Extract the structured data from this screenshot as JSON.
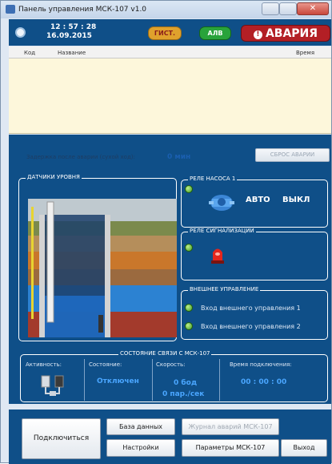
{
  "window": {
    "title": "Панель управления МСК-107 v1.0",
    "close_glyph": "✕"
  },
  "status_bar": {
    "time": "12 : 57 : 28",
    "date": "16.09.2015",
    "badge_gist": "ГИСТ.",
    "badge_alv": "АЛВ",
    "badge_alarm": "АВАРИЯ"
  },
  "event_table": {
    "columns": [
      "Код",
      "Название",
      "Время"
    ],
    "rows": []
  },
  "delay": {
    "label": "Задержка после аварии (сухой ход):",
    "value": "0 мин",
    "reset_button": "СБРОС АВАРИИ"
  },
  "level_sensors": {
    "title": "ДАТЧИКИ УРОВНЯ"
  },
  "pump_relay": {
    "title": "РЕЛЕ НАСОСА 1",
    "mode_auto": "АВТО",
    "mode_off": "ВЫКЛ"
  },
  "alarm_relay": {
    "title": "РЕЛЕ СИГНАЛИЗАЦИИ"
  },
  "external_control": {
    "title": "ВНЕШНЕЕ УПРАВЛЕНИЕ",
    "inputs": [
      "Вход внешнего управления 1",
      "Вход внешнего управления 2"
    ]
  },
  "connection": {
    "title": "СОСТОЯНИЕ СВЯЗИ С МСК-107",
    "activity_label": "Активность:",
    "state_label": "Состояние:",
    "state_value": "Отключен",
    "speed_label": "Скорость:",
    "speed_baud": "0 бод",
    "speed_packets": "0 пар./сек",
    "uptime_label": "Время подключения:",
    "uptime_value": "00 : 00 : 00"
  },
  "buttons": {
    "connect": "Подключиться",
    "database": "База данных",
    "alarm_log": "Журнал аварий МСК-107",
    "settings": "Настройки",
    "parameters": "Параметры МСК-107",
    "exit": "Выход"
  },
  "colors": {
    "panel": "#0f4f88",
    "table_bg": "#fdf7db",
    "alarm": "#b31f25",
    "led_on": "#3d9a1f",
    "value_text": "#1a5fb0"
  }
}
